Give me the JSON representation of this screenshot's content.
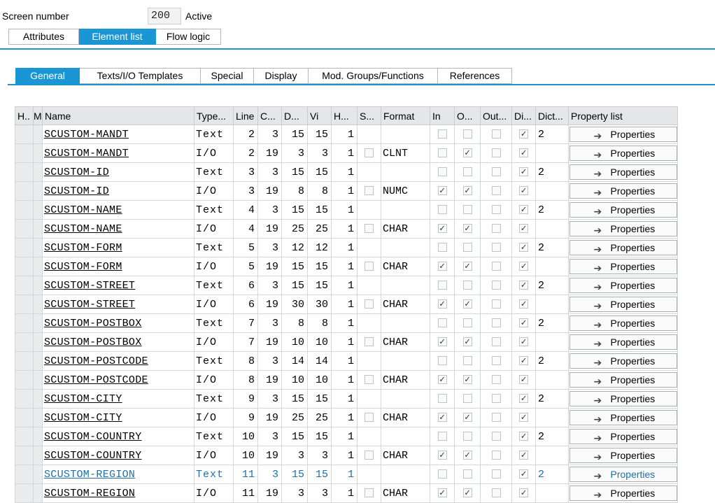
{
  "header": {
    "screen_label": "Screen number",
    "screen_number": "200",
    "status": "Active"
  },
  "main_tabs": [
    {
      "label": "Attributes",
      "active": false
    },
    {
      "label": "Element list",
      "active": true
    },
    {
      "label": "Flow logic",
      "active": false
    }
  ],
  "sub_tabs": [
    {
      "label": "General",
      "active": true
    },
    {
      "label": "Texts/I/O Templates",
      "active": false
    },
    {
      "label": "Special",
      "active": false
    },
    {
      "label": "Display",
      "active": false
    },
    {
      "label": "Mod. Groups/Functions",
      "active": false
    },
    {
      "label": "References",
      "active": false
    }
  ],
  "columns": [
    "H..",
    "M",
    "Name",
    "Type...",
    "Line",
    "C...",
    "D...",
    "Vi",
    "H...",
    "S...",
    "Format",
    "In",
    "O...",
    "Out...",
    "Di...",
    "Dict...",
    "Property list"
  ],
  "property_button_label": "Properties",
  "rows": [
    {
      "name": "SCUSTOM-MANDT",
      "type": "Text",
      "line": "2",
      "col": "3",
      "def": "15",
      "vis": "15",
      "h": "1",
      "s": false,
      "format": "",
      "in": false,
      "out": false,
      "outonly": false,
      "di": true,
      "dict": "2"
    },
    {
      "name": "SCUSTOM-MANDT",
      "type": "I/O",
      "line": "2",
      "col": "19",
      "def": "3",
      "vis": "3",
      "h": "1",
      "s": false,
      "format": "CLNT",
      "in": false,
      "out": true,
      "outonly": false,
      "di": true,
      "dict": ""
    },
    {
      "name": "SCUSTOM-ID",
      "type": "Text",
      "line": "3",
      "col": "3",
      "def": "15",
      "vis": "15",
      "h": "1",
      "s": false,
      "format": "",
      "in": false,
      "out": false,
      "outonly": false,
      "di": true,
      "dict": "2"
    },
    {
      "name": "SCUSTOM-ID",
      "type": "I/O",
      "line": "3",
      "col": "19",
      "def": "8",
      "vis": "8",
      "h": "1",
      "s": false,
      "format": "NUMC",
      "in": true,
      "out": true,
      "outonly": false,
      "di": true,
      "dict": ""
    },
    {
      "name": "SCUSTOM-NAME",
      "type": "Text",
      "line": "4",
      "col": "3",
      "def": "15",
      "vis": "15",
      "h": "1",
      "s": false,
      "format": "",
      "in": false,
      "out": false,
      "outonly": false,
      "di": true,
      "dict": "2"
    },
    {
      "name": "SCUSTOM-NAME",
      "type": "I/O",
      "line": "4",
      "col": "19",
      "def": "25",
      "vis": "25",
      "h": "1",
      "s": false,
      "format": "CHAR",
      "in": true,
      "out": true,
      "outonly": false,
      "di": true,
      "dict": ""
    },
    {
      "name": "SCUSTOM-FORM",
      "type": "Text",
      "line": "5",
      "col": "3",
      "def": "12",
      "vis": "12",
      "h": "1",
      "s": false,
      "format": "",
      "in": false,
      "out": false,
      "outonly": false,
      "di": true,
      "dict": "2"
    },
    {
      "name": "SCUSTOM-FORM",
      "type": "I/O",
      "line": "5",
      "col": "19",
      "def": "15",
      "vis": "15",
      "h": "1",
      "s": false,
      "format": "CHAR",
      "in": true,
      "out": true,
      "outonly": false,
      "di": true,
      "dict": ""
    },
    {
      "name": "SCUSTOM-STREET",
      "type": "Text",
      "line": "6",
      "col": "3",
      "def": "15",
      "vis": "15",
      "h": "1",
      "s": false,
      "format": "",
      "in": false,
      "out": false,
      "outonly": false,
      "di": true,
      "dict": "2"
    },
    {
      "name": "SCUSTOM-STREET",
      "type": "I/O",
      "line": "6",
      "col": "19",
      "def": "30",
      "vis": "30",
      "h": "1",
      "s": false,
      "format": "CHAR",
      "in": true,
      "out": true,
      "outonly": false,
      "di": true,
      "dict": ""
    },
    {
      "name": "SCUSTOM-POSTBOX",
      "type": "Text",
      "line": "7",
      "col": "3",
      "def": "8",
      "vis": "8",
      "h": "1",
      "s": false,
      "format": "",
      "in": false,
      "out": false,
      "outonly": false,
      "di": true,
      "dict": "2"
    },
    {
      "name": "SCUSTOM-POSTBOX",
      "type": "I/O",
      "line": "7",
      "col": "19",
      "def": "10",
      "vis": "10",
      "h": "1",
      "s": false,
      "format": "CHAR",
      "in": true,
      "out": true,
      "outonly": false,
      "di": true,
      "dict": ""
    },
    {
      "name": "SCUSTOM-POSTCODE",
      "type": "Text",
      "line": "8",
      "col": "3",
      "def": "14",
      "vis": "14",
      "h": "1",
      "s": false,
      "format": "",
      "in": false,
      "out": false,
      "outonly": false,
      "di": true,
      "dict": "2"
    },
    {
      "name": "SCUSTOM-POSTCODE",
      "type": "I/O",
      "line": "8",
      "col": "19",
      "def": "10",
      "vis": "10",
      "h": "1",
      "s": false,
      "format": "CHAR",
      "in": true,
      "out": true,
      "outonly": false,
      "di": true,
      "dict": ""
    },
    {
      "name": "SCUSTOM-CITY",
      "type": "Text",
      "line": "9",
      "col": "3",
      "def": "15",
      "vis": "15",
      "h": "1",
      "s": false,
      "format": "",
      "in": false,
      "out": false,
      "outonly": false,
      "di": true,
      "dict": "2"
    },
    {
      "name": "SCUSTOM-CITY",
      "type": "I/O",
      "line": "9",
      "col": "19",
      "def": "25",
      "vis": "25",
      "h": "1",
      "s": false,
      "format": "CHAR",
      "in": true,
      "out": true,
      "outonly": false,
      "di": true,
      "dict": ""
    },
    {
      "name": "SCUSTOM-COUNTRY",
      "type": "Text",
      "line": "10",
      "col": "3",
      "def": "15",
      "vis": "15",
      "h": "1",
      "s": false,
      "format": "",
      "in": false,
      "out": false,
      "outonly": false,
      "di": true,
      "dict": "2"
    },
    {
      "name": "SCUSTOM-COUNTRY",
      "type": "I/O",
      "line": "10",
      "col": "19",
      "def": "3",
      "vis": "3",
      "h": "1",
      "s": false,
      "format": "CHAR",
      "in": true,
      "out": true,
      "outonly": false,
      "di": true,
      "dict": ""
    },
    {
      "name": "SCUSTOM-REGION",
      "type": "Text",
      "line": "11",
      "col": "3",
      "def": "15",
      "vis": "15",
      "h": "1",
      "s": false,
      "format": "",
      "in": false,
      "out": false,
      "outonly": false,
      "di": true,
      "dict": "2",
      "highlight": true
    },
    {
      "name": "SCUSTOM-REGION",
      "type": "I/O",
      "line": "11",
      "col": "19",
      "def": "3",
      "vis": "3",
      "h": "1",
      "s": false,
      "format": "CHAR",
      "in": true,
      "out": true,
      "outonly": false,
      "di": true,
      "dict": ""
    }
  ]
}
